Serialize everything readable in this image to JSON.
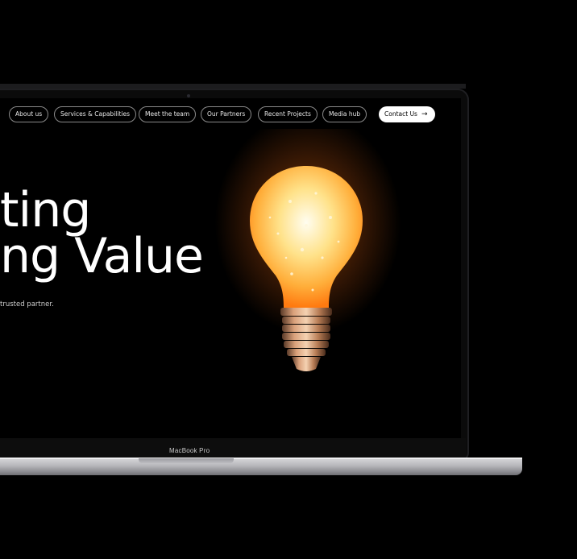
{
  "nav": {
    "items": [
      "About us",
      "Services & Capabilities",
      "Meet the team",
      "Our Partners",
      "Recent Projects",
      "Media hub"
    ],
    "contact_label": "Contact Us"
  },
  "hero": {
    "line1": "ting",
    "line2": "ng Value",
    "subtitle": "trusted partner."
  },
  "device": {
    "label": "MacBook Pro"
  },
  "colors": {
    "background": "#000000",
    "text": "#ffffff",
    "glow": "#ff9a2e",
    "contact_button": "#ffffff"
  }
}
